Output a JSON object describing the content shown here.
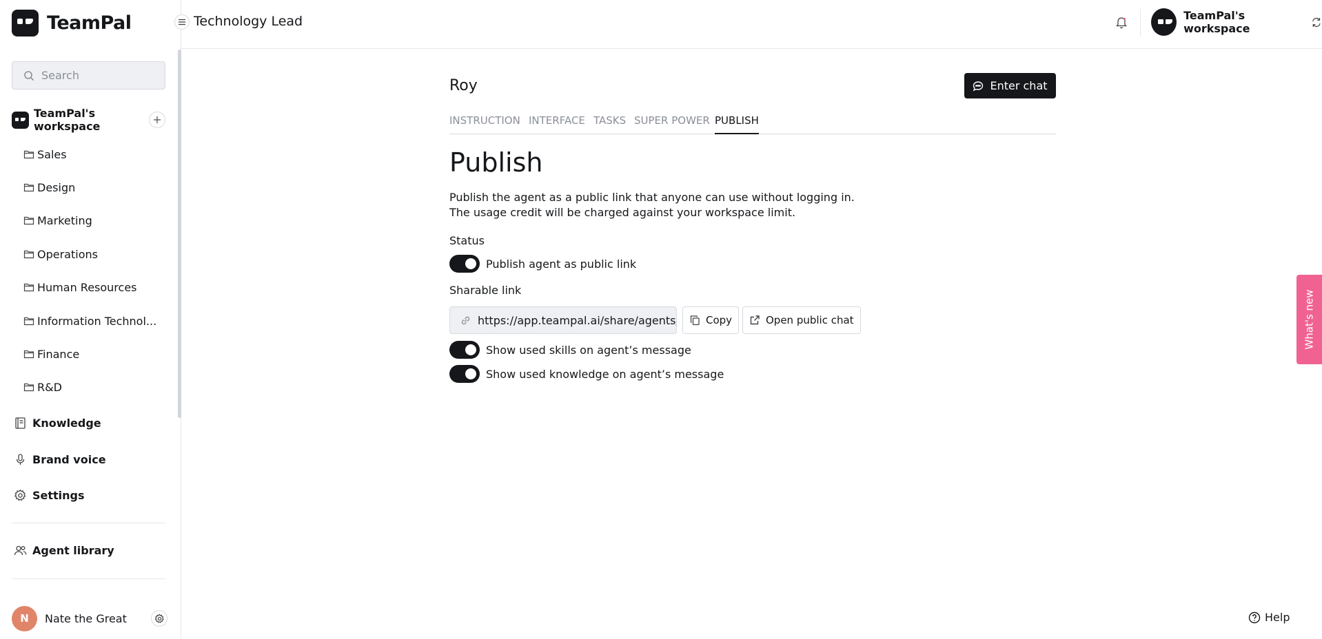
{
  "app": {
    "name": "TeamPal"
  },
  "sidebar": {
    "search_placeholder": "Search",
    "workspace_name": "TeamPal's workspace",
    "folders": [
      {
        "label": "Sales"
      },
      {
        "label": "Design"
      },
      {
        "label": "Marketing"
      },
      {
        "label": "Operations"
      },
      {
        "label": "Human Resources"
      },
      {
        "label": "Information Technol..."
      },
      {
        "label": "Finance"
      },
      {
        "label": "R&D"
      }
    ],
    "nav": {
      "knowledge": "Knowledge",
      "brand_voice": "Brand voice",
      "settings": "Settings",
      "agent_library": "Agent library"
    },
    "user": {
      "initial": "N",
      "name": "Nate the Great"
    }
  },
  "header": {
    "page_title": "Technology Lead",
    "workspace_name": "TeamPal's workspace"
  },
  "main": {
    "agent_name": "Roy",
    "enter_chat": "Enter chat",
    "tabs": [
      {
        "label": "INSTRUCTION",
        "active": false
      },
      {
        "label": "INTERFACE",
        "active": false
      },
      {
        "label": "TASKS",
        "active": false
      },
      {
        "label": "SUPER POWER",
        "active": false
      },
      {
        "label": "PUBLISH",
        "active": true
      }
    ],
    "heading": "Publish",
    "description_line1": "Publish the agent as a public link that anyone can use without logging in.",
    "description_line2": "The usage credit will be charged against your workspace limit.",
    "status_label": "Status",
    "publish_toggle": {
      "label": "Publish agent as public link",
      "on": true
    },
    "sharable_label": "Sharable link",
    "sharable_url": "https://app.teampal.ai/share/agents/",
    "copy_label": "Copy",
    "open_public_chat_label": "Open public chat",
    "skills_toggle": {
      "label": "Show used skills on agent’s message",
      "on": true
    },
    "knowledge_toggle": {
      "label": "Show used knowledge on agent’s message",
      "on": true
    }
  },
  "widgets": {
    "whats_new": "What's new",
    "help": "Help"
  },
  "colors": {
    "primary": "#15171a",
    "whats_new_bg": "#f06292",
    "avatar_bg": "#e0856a",
    "muted_text": "#8a8f98"
  },
  "icons": [
    "search-icon",
    "plus-icon",
    "folder-icon",
    "book-icon",
    "microphone-icon",
    "gear-icon",
    "users-icon",
    "menu-icon",
    "bell-icon",
    "switch-icon",
    "chat-icon",
    "link-icon",
    "copy-icon",
    "external-link-icon",
    "help-icon"
  ]
}
